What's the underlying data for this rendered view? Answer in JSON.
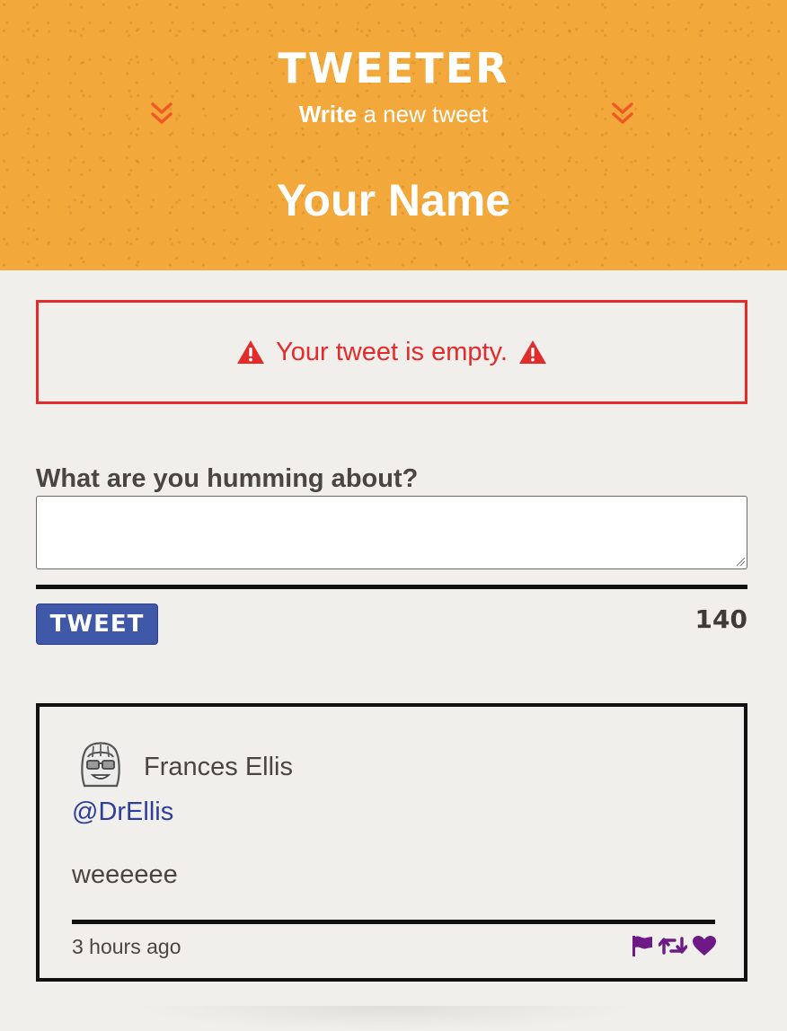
{
  "header": {
    "brand": "TWEETER",
    "subtitle_bold": "Write",
    "subtitle_rest": " a new tweet",
    "username": "Your Name"
  },
  "error": {
    "message": "Your tweet is empty."
  },
  "compose": {
    "label": "What are you humming about?",
    "value": "",
    "placeholder": "",
    "button_label": "TWEET",
    "counter": "140"
  },
  "tweets": [
    {
      "author": "Frances Ellis",
      "handle": "@DrEllis",
      "text": "weeeeee",
      "time": "3 hours ago",
      "actions": [
        "flag-icon",
        "retweet-icon",
        "heart-icon"
      ]
    }
  ],
  "colors": {
    "header_bg": "#f2a83b",
    "accent_chevron": "#ef5a24",
    "error": "#e32b2b",
    "button": "#3f58a8",
    "handle": "#2f3f99",
    "action_icon": "#6e1a86",
    "page_bg": "#f1efeb"
  }
}
